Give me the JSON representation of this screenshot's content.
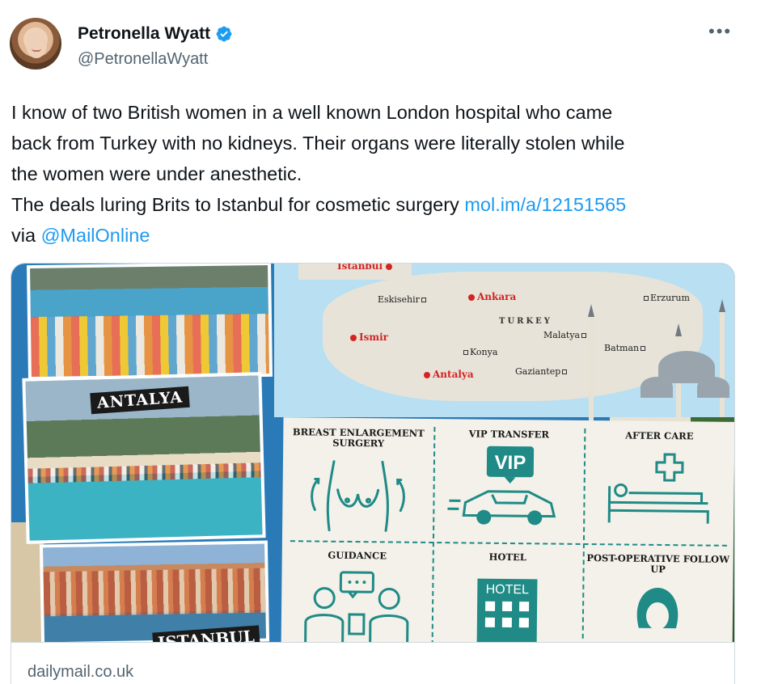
{
  "author": {
    "display_name": "Petronella Wyatt",
    "handle": "@PetronellaWyatt",
    "verified": true,
    "avatar_icon": "profile-photo"
  },
  "more_icon": "more-horizontal-icon",
  "tweet": {
    "lines": [
      "I know of two British women in a well known London hospital who came",
      "back from Turkey with no kidneys. Their organs were literally stolen while",
      "the women were under anesthetic."
    ],
    "line4_text": "The deals luring Brits to Istanbul for cosmetic surgery ",
    "link_url_text": "mol.im/a/12151565",
    "line5_prefix": "via ",
    "mention": "@MailOnline"
  },
  "card": {
    "domain": "dailymail.co.uk",
    "collage_labels": {
      "antalya": "ANTALYA",
      "istanbul_partial": "ISTANBUL"
    },
    "map": {
      "country": "TURKEY",
      "cities_red": [
        "Istanbul",
        "Ankara",
        "Ismir",
        "Antalya"
      ],
      "cities": [
        "Eskisehir",
        "Erzurum",
        "Malatya",
        "Konya",
        "Batman",
        "Gaziantep"
      ]
    },
    "services": [
      {
        "label": "BREAST ENLARGEMENT SURGERY",
        "icon": "breast-surgery-icon"
      },
      {
        "label": "VIP TRANSFER",
        "icon": "vip-car-icon",
        "badge": "VIP"
      },
      {
        "label": "AFTER CARE",
        "icon": "hospital-bed-icon"
      },
      {
        "label": "GUIDANCE",
        "icon": "consultation-icon"
      },
      {
        "label": "HOTEL",
        "icon": "hotel-icon",
        "badge": "HOTEL"
      },
      {
        "label": "POST-OPERATIVE FOLLOW UP",
        "icon": "nurse-icon"
      }
    ]
  },
  "colors": {
    "link": "#1d9bf0",
    "verified": "#1d9bf0",
    "secondary_text": "#536471",
    "icon_teal": "#1f8a86",
    "map_red": "#d42323"
  }
}
